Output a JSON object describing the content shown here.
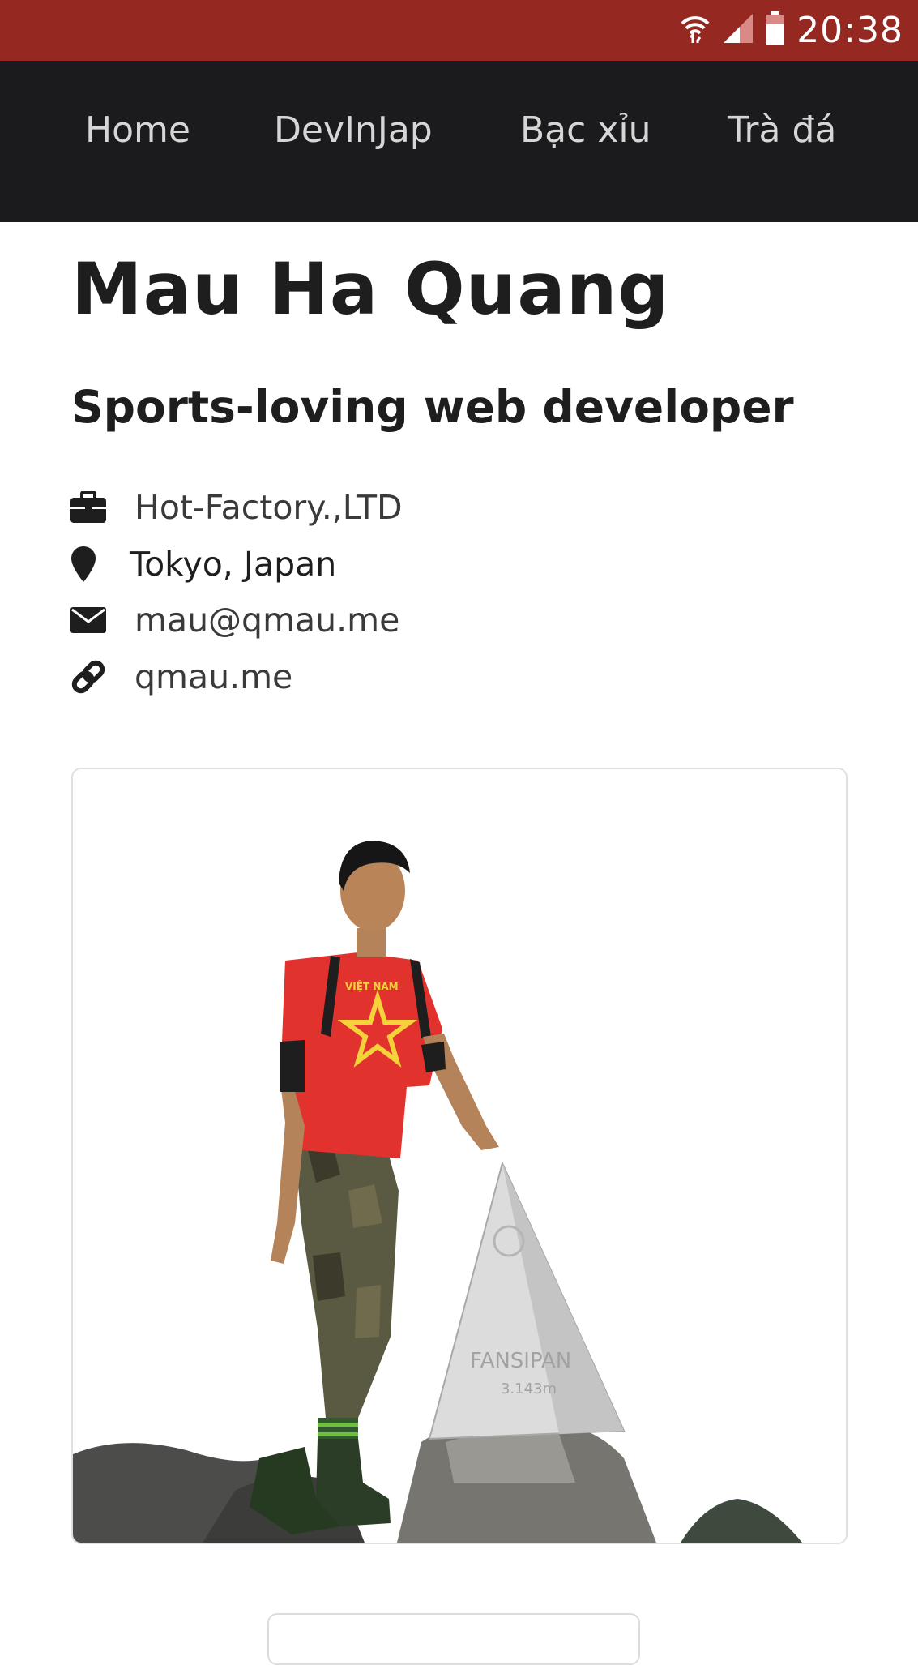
{
  "status_bar": {
    "time": "20:38",
    "icons": [
      "wifi-icon",
      "signal-icon",
      "battery-icon"
    ]
  },
  "nav": {
    "items": [
      {
        "label": "Home"
      },
      {
        "label": "DevInJap"
      },
      {
        "label": "Bạc xỉu"
      },
      {
        "label": "Trà đá"
      }
    ]
  },
  "profile": {
    "name": "Mau Ha Quang",
    "tagline": "Sports-loving web developer",
    "company": "Hot-Factory.,LTD",
    "location": "Tokyo, Japan",
    "email": "mau@qmau.me",
    "website": "qmau.me"
  },
  "photo": {
    "shirt_text": "VIỆT NAM",
    "marker_text": "FANSIPAN",
    "marker_height": "3.143m"
  },
  "colors": {
    "status_bar": "#962822",
    "navbar": "#1b1b1d",
    "nav_text": "#d6d6d6",
    "text_dark": "#1e1e1e"
  }
}
